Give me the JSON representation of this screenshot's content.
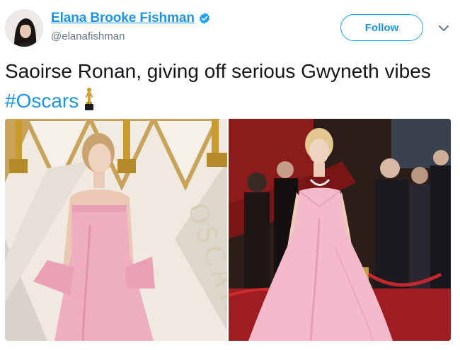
{
  "tweet": {
    "author": {
      "display_name": "Elana Brooke Fishman",
      "handle": "@elanafishman",
      "verified": true,
      "avatar_icon": "avatar-photo"
    },
    "follow_label": "Follow",
    "menu_icon": "chevron-down-icon",
    "text": "Saoirse Ronan, giving off serious Gwyneth vibes ",
    "hashtag": "#Oscars",
    "emoji_icon": "oscar-trophy-icon",
    "photos": [
      {
        "subject": "woman in strapless pink gown on Oscars red carpet",
        "backdrop_text": "OSCARS"
      },
      {
        "subject": "woman in pink satin gown on red carpet with crowd"
      }
    ]
  },
  "colors": {
    "link_blue": "#1b95e0",
    "verified_blue": "#1da1f2",
    "text_dark": "#14171a",
    "handle_gray": "#657786"
  }
}
